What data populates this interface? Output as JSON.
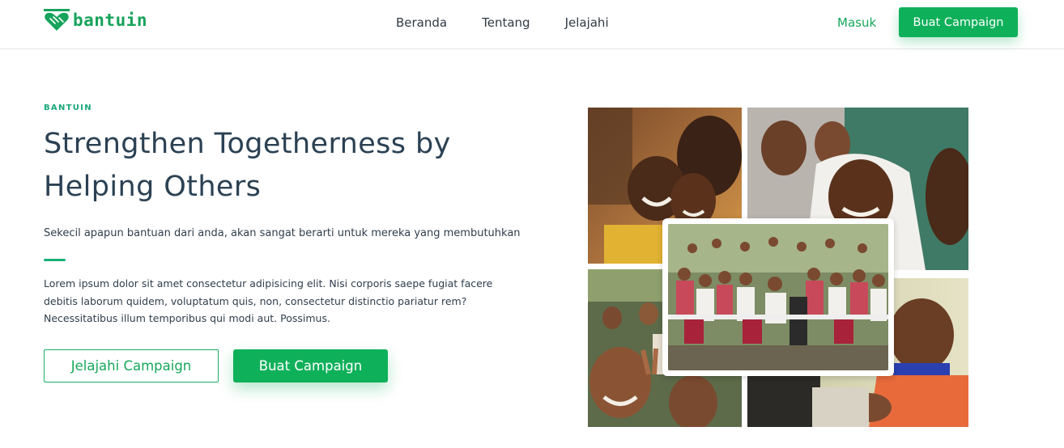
{
  "brand": {
    "name": "bantuin",
    "color": "#16a35a"
  },
  "nav": {
    "links": [
      "Beranda",
      "Tentang",
      "Jelajahi"
    ],
    "login": "Masuk",
    "cta": "Buat Campaign"
  },
  "hero": {
    "eyebrow": "BANTUIN",
    "title_line1": "Strengthen Togetherness by",
    "title_line2": "Helping Others",
    "tagline": "Sekecil apapun bantuan dari anda, akan sangat berarti untuk mereka yang membutuhkan",
    "body_line1": "Lorem ipsum dolor sit amet consectetur adipisicing elit. Nisi corporis saepe fugiat facere",
    "body_line2": "debitis laborum quidem, voluptatum quis, non, consectetur distinctio pariatur rem?",
    "body_line3": "Necessitatibus illum temporibus qui modi aut. Possimus.",
    "primary_button": "Jelajahi Campaign",
    "secondary_button": "Buat Campaign"
  },
  "gallery": {
    "photos": [
      "smiling-children-photo",
      "girls-in-headscarves-photo",
      "children-waving-photo",
      "baby-photo",
      "school-group-photo"
    ]
  },
  "colors": {
    "accent": "#0fb05a",
    "heading": "#2b4153",
    "eyebrow": "#1aa879"
  }
}
